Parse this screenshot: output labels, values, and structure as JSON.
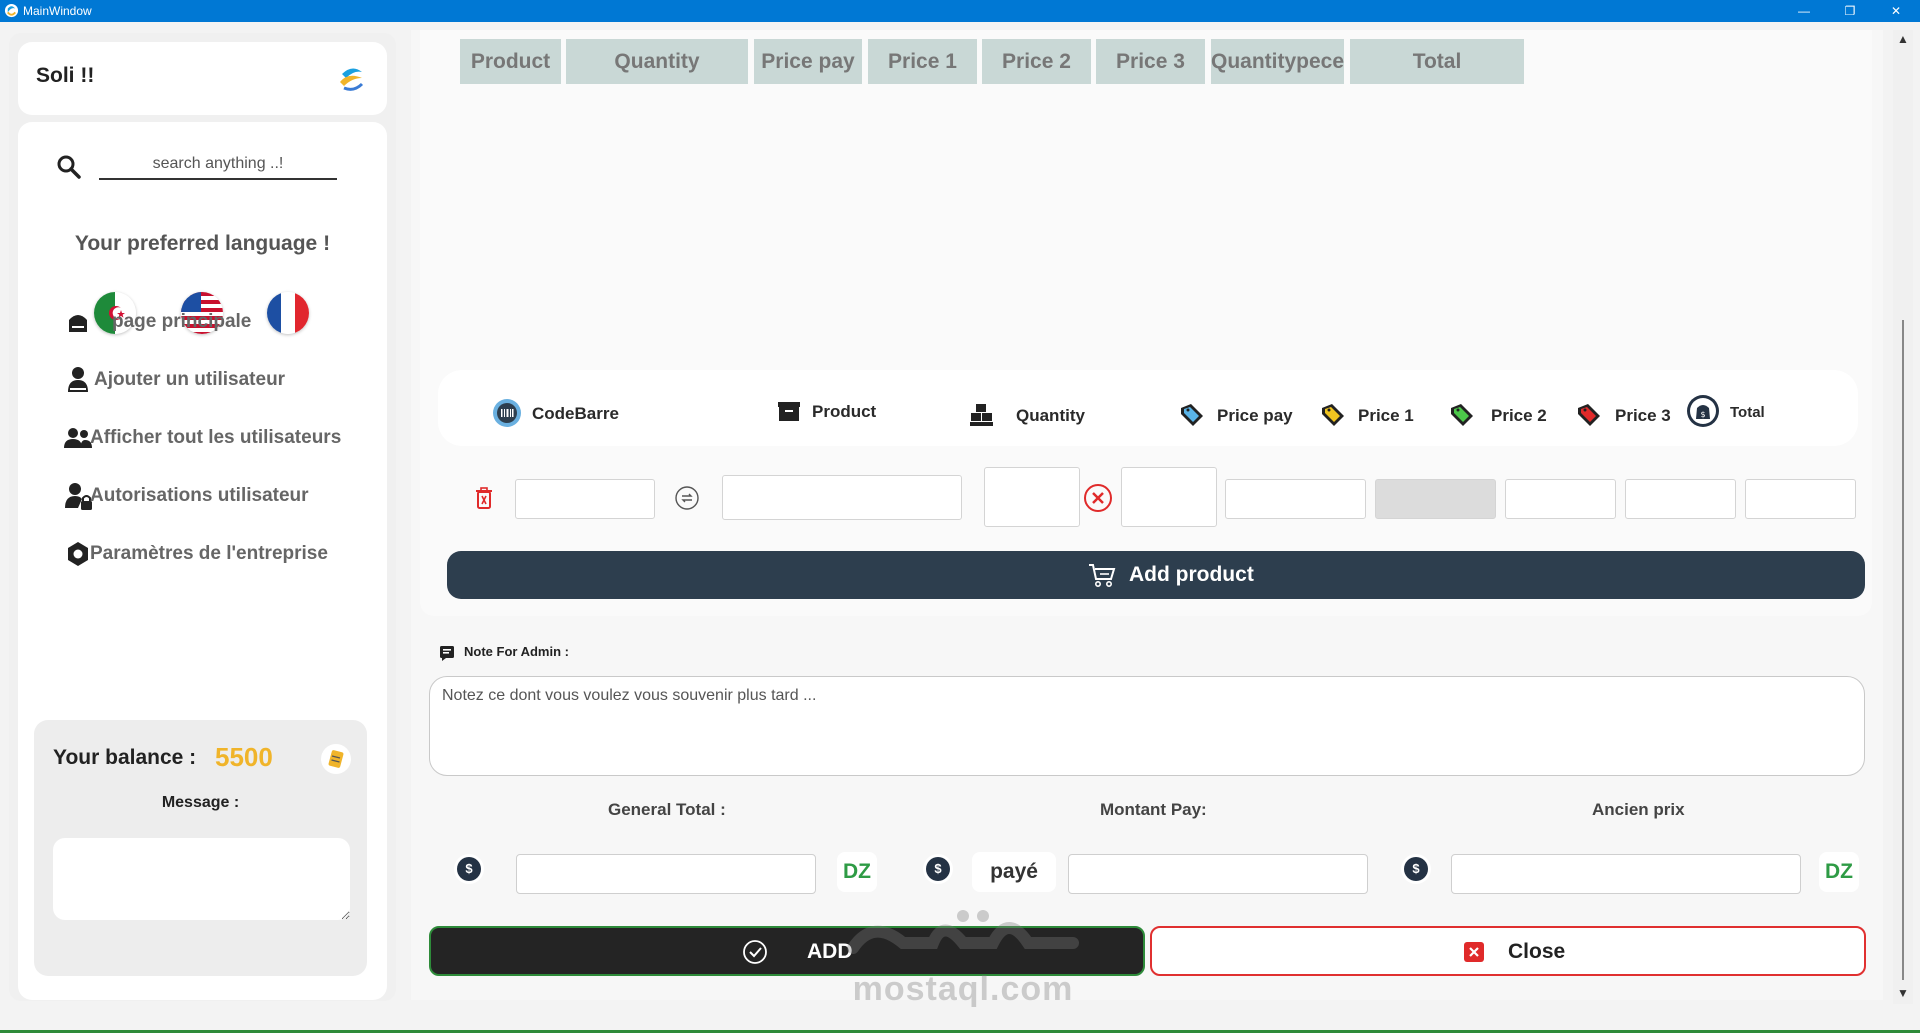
{
  "window": {
    "title": "MainWindow",
    "controls": [
      "—",
      "❐",
      "✕"
    ]
  },
  "brand": {
    "name": "Soli !!",
    "logo_icon": "app-logo"
  },
  "search": {
    "placeholder": "search anything ..!"
  },
  "language": {
    "title": "Your preferred language !",
    "flags": [
      "algeria-flag",
      "usa-flag",
      "france-flag"
    ]
  },
  "nav": {
    "items": [
      {
        "label": "page principale",
        "icon": "home-icon"
      },
      {
        "label": "Ajouter un utilisateur",
        "icon": "add-user-icon"
      },
      {
        "label": "Afficher tout les utilisateurs",
        "icon": "users-icon"
      },
      {
        "label": "Autorisations utilisateur",
        "icon": "user-lock-icon"
      },
      {
        "label": "Paramètres de l'entreprise",
        "icon": "settings-icon"
      }
    ]
  },
  "balance": {
    "label": "Your balance :",
    "value": "5500",
    "message_label": "Message :",
    "accent": "#f0b42a"
  },
  "table": {
    "headers": [
      "Product",
      "Quantity",
      "Price pay",
      "Price 1",
      "Price 2",
      "Price 3",
      "Quantitypece",
      "Total"
    ],
    "header_bg": "#c9d8d6"
  },
  "fields": {
    "labels": [
      "CodeBarre",
      "Product",
      "Quantity",
      "Price pay",
      "Price 1",
      "Price 2",
      "Price 3",
      "Total"
    ]
  },
  "actions": {
    "add_product": "Add product",
    "add": "ADD",
    "close": "Close",
    "dark": "#2d3e4e",
    "danger": "#e03030",
    "success": "#2e8b3a"
  },
  "note": {
    "label": "Note For Admin :",
    "placeholder": "Notez ce dont vous voulez vous souvenir plus tard ..."
  },
  "summary": {
    "general_total": "General Total :",
    "montant_pay": "Montant Pay:",
    "ancien_prix": "Ancien prix",
    "currency": "DZ",
    "dollar_symbol": "$",
    "paid_tag": "payé"
  },
  "watermark": {
    "text": "mostaql.com"
  }
}
